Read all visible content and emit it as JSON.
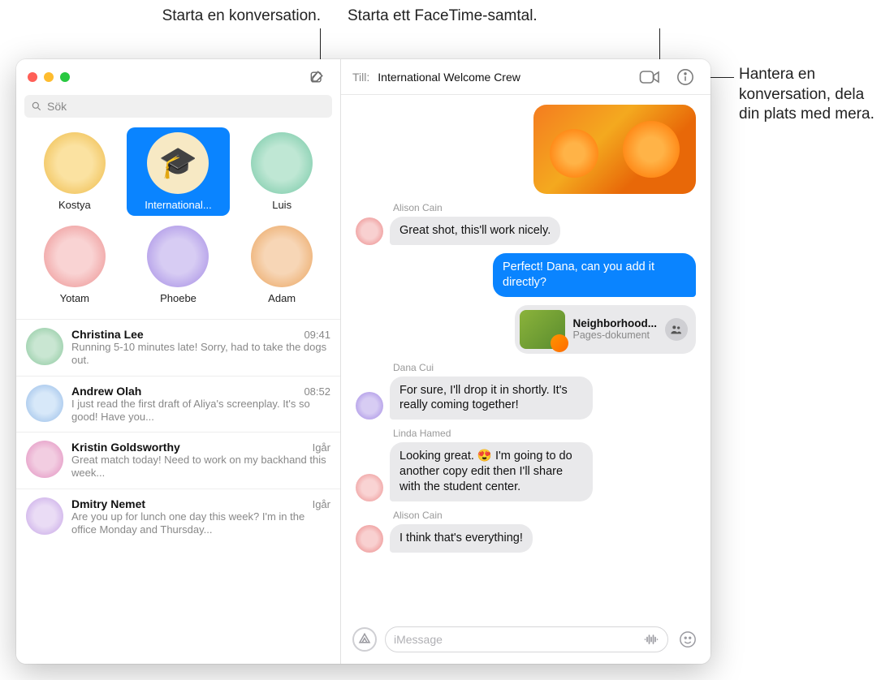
{
  "callouts": {
    "compose": "Starta en konversation.",
    "facetime": "Starta ett FaceTime-samtal.",
    "info": "Hantera en konversation, dela din plats med mera."
  },
  "search": {
    "placeholder": "Sök"
  },
  "pinned": [
    {
      "label": "Kostya"
    },
    {
      "label": "International..."
    },
    {
      "label": "Luis"
    },
    {
      "label": "Yotam"
    },
    {
      "label": "Phoebe"
    },
    {
      "label": "Adam"
    }
  ],
  "conversations": [
    {
      "name": "Christina Lee",
      "time": "09:41",
      "preview": "Running 5-10 minutes late! Sorry, had to take the dogs out."
    },
    {
      "name": "Andrew Olah",
      "time": "08:52",
      "preview": "I just read the first draft of Aliya's screenplay. It's so good! Have you..."
    },
    {
      "name": "Kristin Goldsworthy",
      "time": "Igår",
      "preview": "Great match today! Need to work on my backhand this week..."
    },
    {
      "name": "Dmitry Nemet",
      "time": "Igår",
      "preview": "Are you up for lunch one day this week? I'm in the office Monday and Thursday..."
    }
  ],
  "header": {
    "toLabel": "Till:",
    "toName": "International Welcome Crew"
  },
  "messages": {
    "alison1": {
      "sender": "Alison Cain",
      "text": "Great shot, this'll work nicely."
    },
    "me": {
      "text": "Perfect! Dana, can you add it directly?"
    },
    "file": {
      "title": "Neighborhood...",
      "subtitle": "Pages-dokument"
    },
    "dana": {
      "sender": "Dana Cui",
      "text": "For sure, I'll drop it in shortly. It's really coming together!"
    },
    "linda": {
      "sender": "Linda Hamed",
      "text": "Looking great. 😍 I'm going to do another copy edit then I'll share with the student center."
    },
    "alison2": {
      "sender": "Alison Cain",
      "text": "I think that's everything!"
    }
  },
  "composer": {
    "placeholder": "iMessage"
  },
  "icons": {
    "grad": "🎓"
  }
}
